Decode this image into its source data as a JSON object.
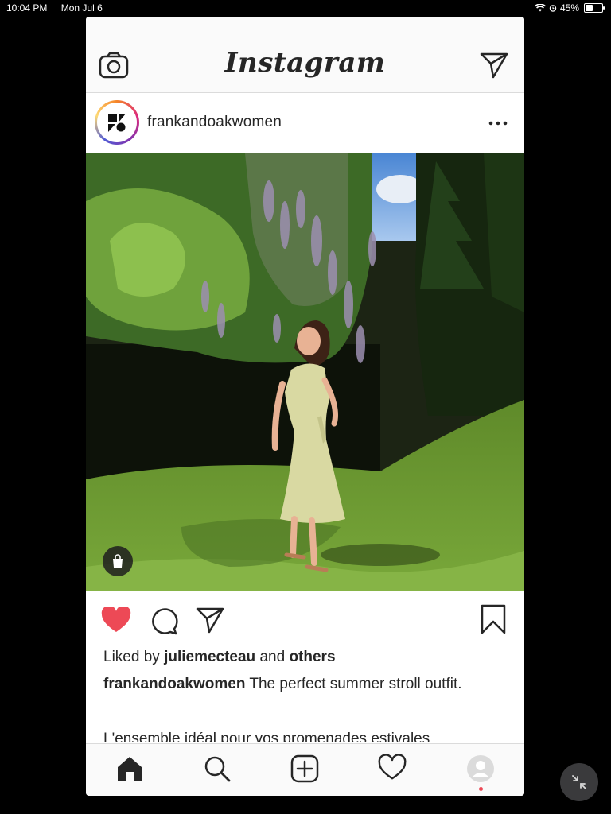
{
  "status_bar": {
    "time": "10:04 PM",
    "date": "Mon Jul 6",
    "battery_percent": "45%",
    "battery_level": 0.45
  },
  "header": {
    "logo": "Instagram",
    "camera_icon": "camera-icon",
    "direct_icon": "paper-plane-icon"
  },
  "post": {
    "username": "frankandoakwomen",
    "more_icon": "more-horizontal-icon",
    "image_description_icon": "shopping-bag-icon",
    "liked": true,
    "likes": {
      "prefix": "Liked by",
      "user": "juliemecteau",
      "and": "and",
      "others": "others"
    },
    "caption": {
      "username": "frankandoakwomen",
      "text": "The perfect summer stroll outfit."
    },
    "caption_line2": "L'ensemble idéal pour vos promenades estivales"
  },
  "tabbar": {
    "items": [
      "home-icon",
      "search-icon",
      "add-icon",
      "heart-icon",
      "profile-icon"
    ],
    "active": "home-icon"
  },
  "colors": {
    "like_red": "#ed4956",
    "border": "#dbdbdb",
    "text": "#262626",
    "bar_bg": "#fafafa"
  }
}
